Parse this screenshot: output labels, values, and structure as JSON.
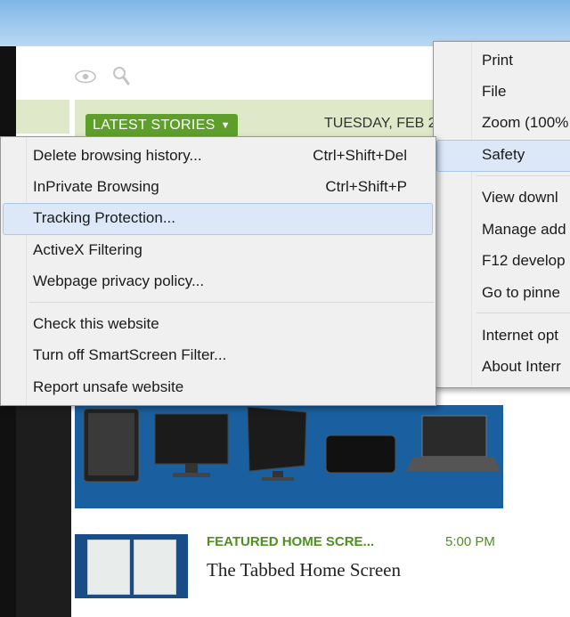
{
  "toolbar": {
    "eye_icon": "eye-icon",
    "search_icon": "search-icon"
  },
  "site": {
    "latest_stories_label": "LATEST STORIES",
    "date_text": "TUESDAY, FEB 2",
    "featured_category": "FEATURED HOME SCRE...",
    "featured_time": "5:00 PM",
    "featured_headline": "The Tabbed Home Screen",
    "colors": {
      "green_bar": "#dfe8c9",
      "brand_green": "#5e9f2b",
      "hero_blue": "#1a5f9f"
    }
  },
  "tools_menu": {
    "items": [
      "Print",
      "File",
      "Zoom (100%",
      "Safety",
      "View downl",
      "Manage add",
      "F12 develop",
      "Go to pinne",
      "Internet opt",
      "About Interr"
    ],
    "highlighted": "Safety"
  },
  "safety_menu": {
    "items": [
      {
        "label": "Delete browsing history...",
        "shortcut": "Ctrl+Shift+Del"
      },
      {
        "label": "InPrivate Browsing",
        "shortcut": "Ctrl+Shift+P"
      },
      {
        "label": "Tracking Protection...",
        "shortcut": ""
      },
      {
        "label": "ActiveX Filtering",
        "shortcut": ""
      },
      {
        "label": "Webpage privacy policy...",
        "shortcut": ""
      },
      {
        "label": "Check this website",
        "shortcut": ""
      },
      {
        "label": "Turn off SmartScreen Filter...",
        "shortcut": ""
      },
      {
        "label": "Report unsafe website",
        "shortcut": ""
      }
    ],
    "highlighted": "Tracking Protection..."
  }
}
